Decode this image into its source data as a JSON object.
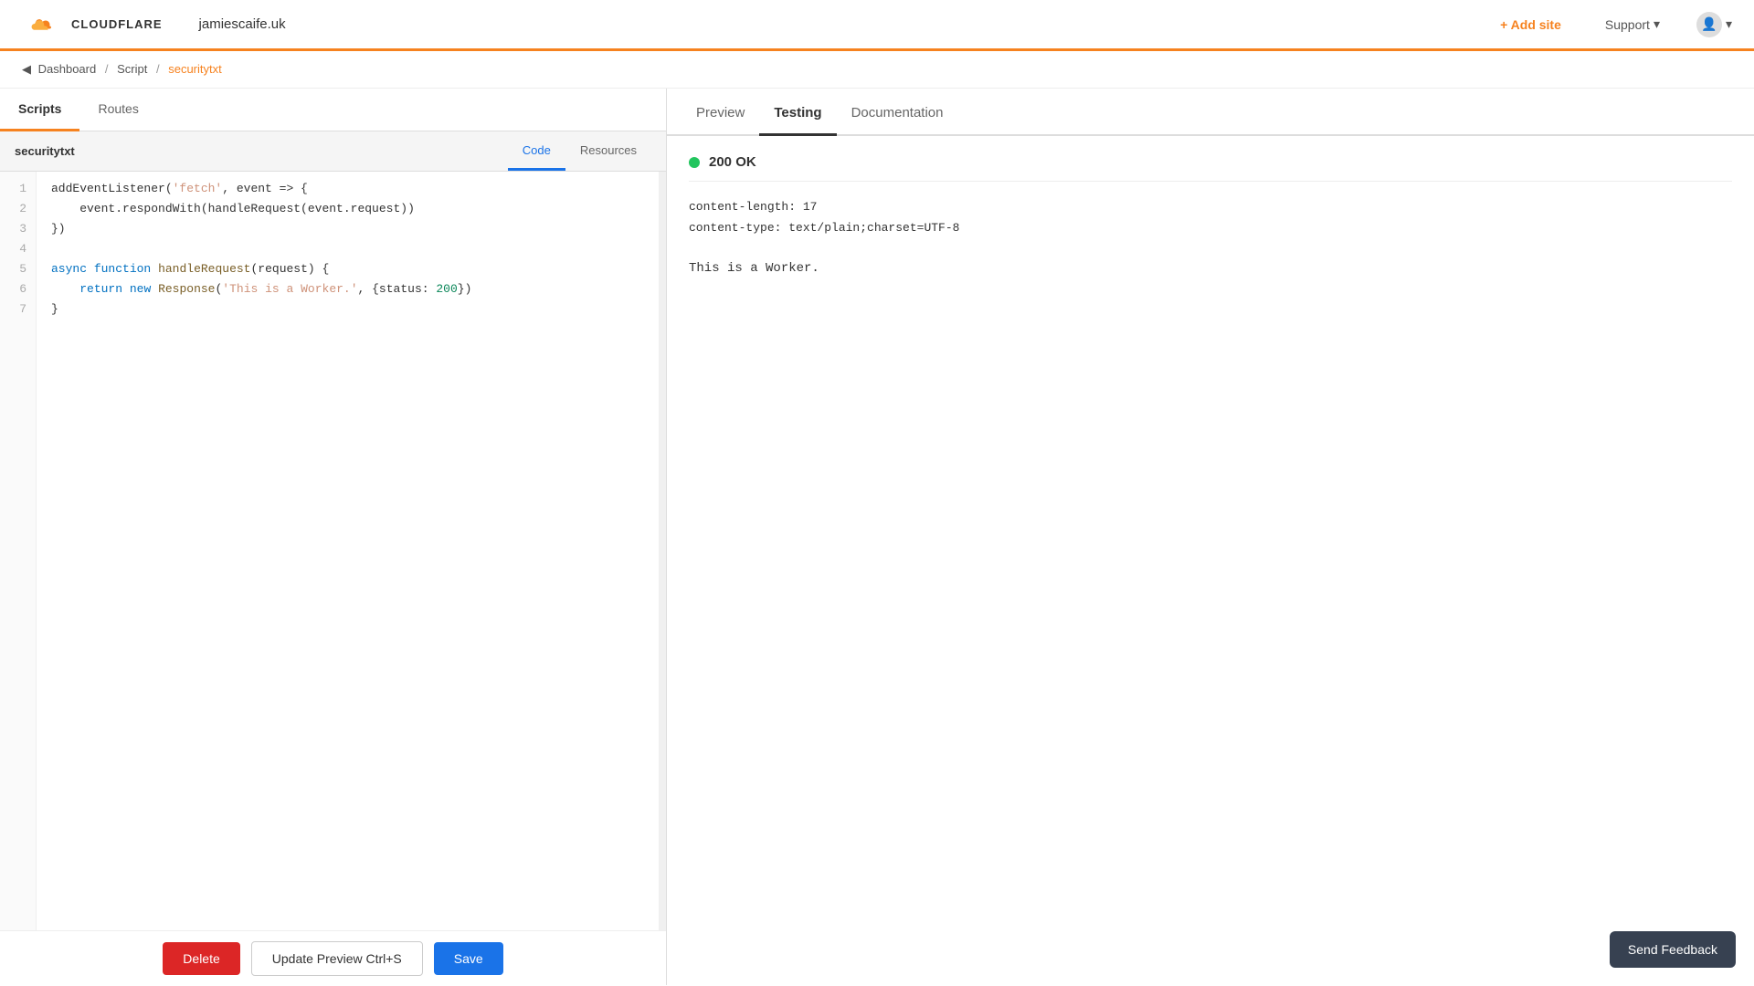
{
  "topnav": {
    "site_name": "jamiescaife.uk",
    "add_site_label": "+ Add site",
    "support_label": "Support",
    "user_icon": "▾"
  },
  "breadcrumb": {
    "dashboard": "Dashboard",
    "script": "Script",
    "current": "securitytxt",
    "sep1": "/",
    "sep2": "/"
  },
  "script_tabs": [
    {
      "label": "Scripts",
      "active": true
    },
    {
      "label": "Routes",
      "active": false
    }
  ],
  "code_header": {
    "filename": "securitytxt",
    "tabs": [
      {
        "label": "Code",
        "active": true
      },
      {
        "label": "Resources",
        "active": false
      }
    ]
  },
  "code": {
    "lines": [
      {
        "num": 1,
        "text": "addEventListener('fetch', event => {"
      },
      {
        "num": 2,
        "text": "    event.respondWith(handleRequest(event.request))"
      },
      {
        "num": 3,
        "text": "})"
      },
      {
        "num": 4,
        "text": ""
      },
      {
        "num": 5,
        "text": "async function handleRequest(request) {"
      },
      {
        "num": 6,
        "text": "    return new Response('This is a Worker.', {status: 200})"
      },
      {
        "num": 7,
        "text": "}"
      }
    ]
  },
  "action_bar": {
    "delete_label": "Delete",
    "update_preview_label": "Update Preview Ctrl+S",
    "save_label": "Save"
  },
  "right_tabs": [
    {
      "label": "Preview",
      "active": false
    },
    {
      "label": "Testing",
      "active": true
    },
    {
      "label": "Documentation",
      "active": false
    }
  ],
  "testing": {
    "status_code": "200 OK",
    "headers": {
      "content_length": "content-length: 17",
      "content_type": "content-type: text/plain;charset=UTF-8"
    },
    "body": "This is a Worker."
  },
  "send_feedback": {
    "label": "Send Feedback"
  }
}
